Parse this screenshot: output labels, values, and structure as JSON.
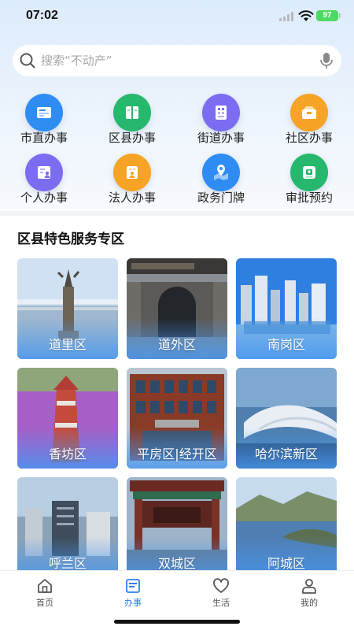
{
  "status_bar": {
    "time": "07:02",
    "battery": "97"
  },
  "search": {
    "placeholder": "搜索“不动产”"
  },
  "services": [
    {
      "label": "市直办事",
      "icon": "document-card-icon",
      "color": "#2f8cf3"
    },
    {
      "label": "区县办事",
      "icon": "book-icon",
      "color": "#26b86d"
    },
    {
      "label": "街道办事",
      "icon": "grid-list-icon",
      "color": "#7c6cf2"
    },
    {
      "label": "社区办事",
      "icon": "briefcase-icon",
      "color": "#f6a326"
    },
    {
      "label": "个人办事",
      "icon": "person-card-icon",
      "color": "#7c6cf2"
    },
    {
      "label": "法人办事",
      "icon": "building-person-icon",
      "color": "#f6a326"
    },
    {
      "label": "政务门牌",
      "icon": "map-pin-icon",
      "color": "#2f8cf3"
    },
    {
      "label": "审批预约",
      "icon": "approval-card-icon",
      "color": "#26b86d"
    }
  ],
  "section": {
    "title": "区县特色服务专区"
  },
  "districts": [
    {
      "label": "道里区"
    },
    {
      "label": "道外区"
    },
    {
      "label": "南岗区"
    },
    {
      "label": "香坊区"
    },
    {
      "label": "平房区|经开区"
    },
    {
      "label": "哈尔滨新区"
    },
    {
      "label": "呼兰区"
    },
    {
      "label": "双城区"
    },
    {
      "label": "阿城区"
    }
  ],
  "tabs": [
    {
      "label": "首页",
      "icon": "home-icon",
      "active": false
    },
    {
      "label": "办事",
      "icon": "document-icon",
      "active": true
    },
    {
      "label": "生活",
      "icon": "heart-icon",
      "active": false
    },
    {
      "label": "我的",
      "icon": "user-icon",
      "active": false
    }
  ],
  "colors": {
    "accent": "#2f7cf0",
    "battery": "#4cd964"
  }
}
